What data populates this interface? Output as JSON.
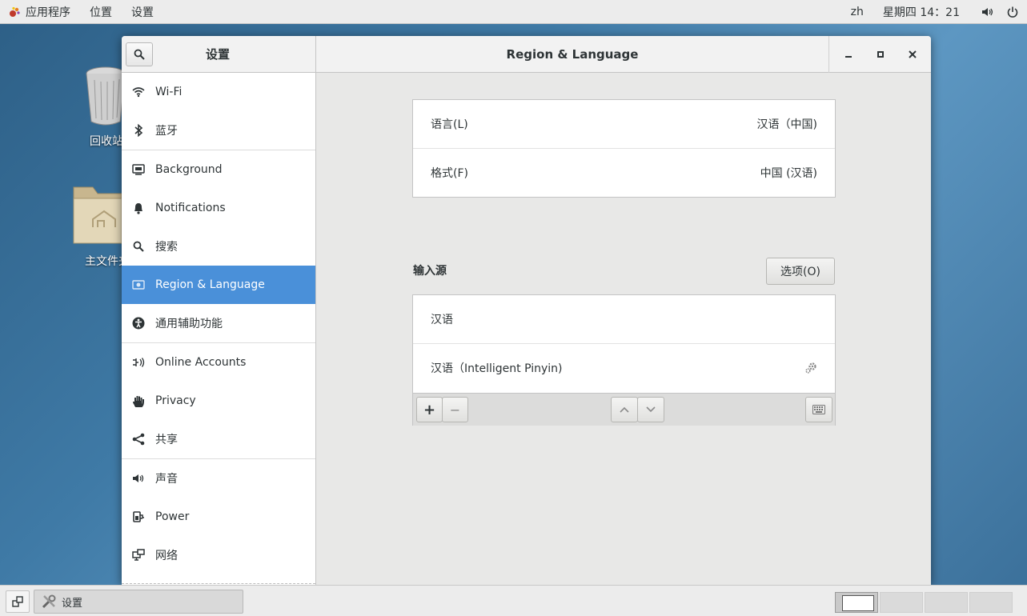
{
  "top_panel": {
    "apps_menu": "应用程序",
    "places_menu": "位置",
    "settings_menu": "设置",
    "input_lang": "zh",
    "clock": "星期四 14：21"
  },
  "desktop": {
    "trash_label": "回收站",
    "home_label": "主文件夹"
  },
  "window": {
    "sidebar_title": "设置",
    "main_title": "Region & Language"
  },
  "sidebar": {
    "items": [
      {
        "label": "Wi-Fi",
        "icon": "wifi-icon"
      },
      {
        "label": "蓝牙",
        "icon": "bluetooth-icon"
      },
      {
        "label": "Background",
        "icon": "background-icon"
      },
      {
        "label": "Notifications",
        "icon": "bell-icon"
      },
      {
        "label": "搜索",
        "icon": "search-icon"
      },
      {
        "label": "Region & Language",
        "icon": "region-icon",
        "active": true
      },
      {
        "label": "通用辅助功能",
        "icon": "accessibility-icon"
      },
      {
        "label": "Online Accounts",
        "icon": "online-accounts-icon"
      },
      {
        "label": "Privacy",
        "icon": "hand-icon"
      },
      {
        "label": "共享",
        "icon": "share-icon"
      },
      {
        "label": "声音",
        "icon": "speaker-icon"
      },
      {
        "label": "Power",
        "icon": "power-plug-icon"
      },
      {
        "label": "网络",
        "icon": "network-icon"
      }
    ]
  },
  "region": {
    "language_label": "语言(L)",
    "language_value": "汉语（中国)",
    "formats_label": "格式(F)",
    "formats_value": "中国 (汉语)"
  },
  "input_sources": {
    "heading": "输入源",
    "options_button": "选项(O)",
    "items": [
      "汉语",
      "汉语（Intelligent Pinyin)"
    ],
    "add_label": "+",
    "remove_label": "−"
  },
  "taskbar": {
    "window_button_label": "设置"
  },
  "colors": {
    "accent": "#4a90d9",
    "window_bg": "#e8e8e7",
    "panel_bg": "#ececec"
  }
}
